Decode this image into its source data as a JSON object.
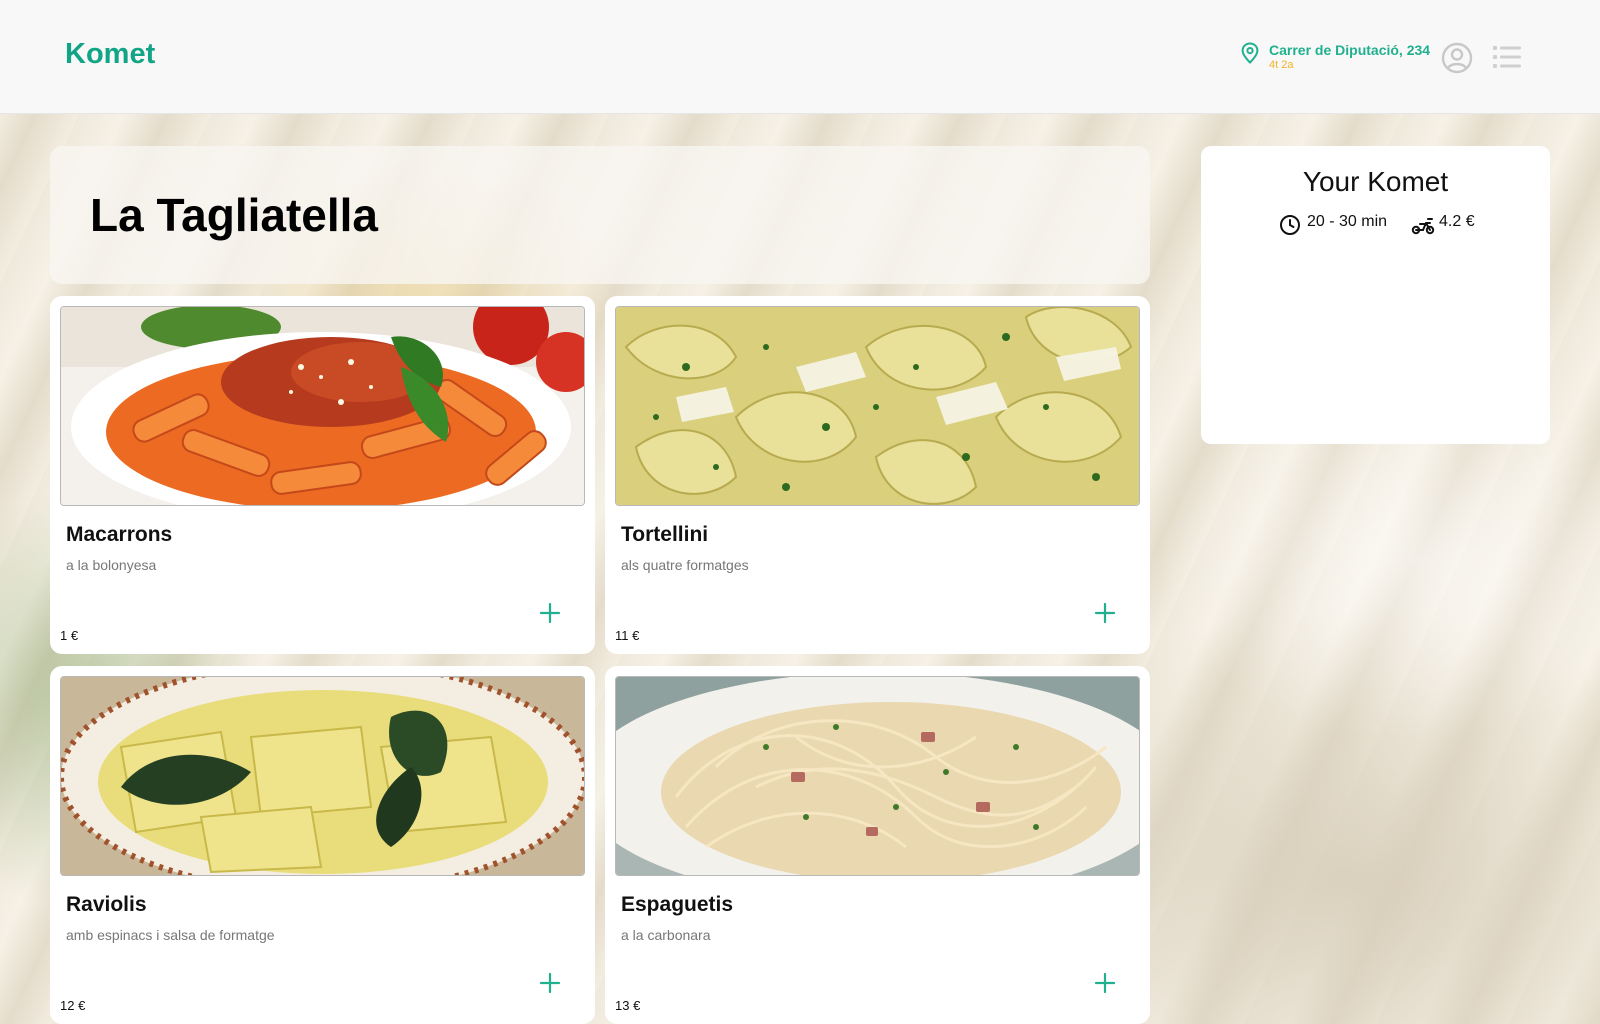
{
  "header": {
    "logo": "Komet",
    "address": "Carrer de Diputació, 234",
    "address_detail": "4t 2a",
    "icons": [
      "location-pin-icon",
      "user-circle-icon",
      "list-menu-icon"
    ]
  },
  "restaurant": {
    "name": "La Tagliatella"
  },
  "products": [
    {
      "name": "Macarrons",
      "description": "a la bolonyesa",
      "price": "1 €",
      "image": "penne bolognese"
    },
    {
      "name": "Tortellini",
      "description": "als quatre formatges",
      "price": "11 €",
      "image": "tortellini four cheese"
    },
    {
      "name": "Raviolis",
      "description": "amb espinacs i salsa de formatge",
      "price": "12 €",
      "image": "ravioli with sage"
    },
    {
      "name": "Espaguetis",
      "description": "a la carbonara",
      "price": "13 €",
      "image": "spaghetti carbonara"
    }
  ],
  "cart": {
    "title": "Your Komet",
    "delivery_time": "20 - 30 min",
    "delivery_fee": "4.2 €"
  },
  "colors": {
    "brand": "#12a486",
    "address": "#21b08f",
    "accent_yellow": "#f0b429",
    "plus_button": "#21b08f"
  }
}
